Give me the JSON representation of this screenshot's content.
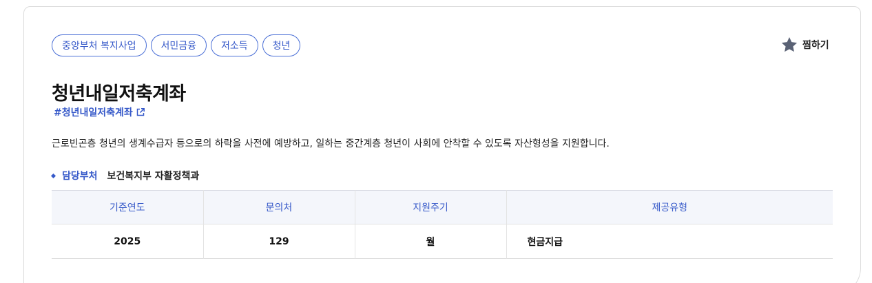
{
  "tags": [
    "중앙부처 복지사업",
    "서민금융",
    "저소득",
    "청년"
  ],
  "bookmark": {
    "label": "찜하기",
    "icon": "star-icon",
    "icon_color": "#5a6275"
  },
  "title": "청년내일저축계좌",
  "hashtag": {
    "text": "#청년내일저축계좌",
    "icon": "external-link-icon"
  },
  "description": "근로빈곤층 청년의 생계수급자 등으로의 하락을 사전에 예방하고, 일하는 중간계층 청년이 사회에 안착할 수 있도록 자산형성을 지원합니다.",
  "department": {
    "label": "담당부처",
    "value": "보건복지부 자활정책과"
  },
  "info_table": {
    "headers": [
      "기준연도",
      "문의처",
      "지원주기",
      "제공유형"
    ],
    "row": [
      "2025",
      "129",
      "월",
      "현금지급"
    ]
  },
  "colors": {
    "accent": "#3659c9",
    "header_bg": "#f4f6fb",
    "border": "#dcdcdc"
  }
}
